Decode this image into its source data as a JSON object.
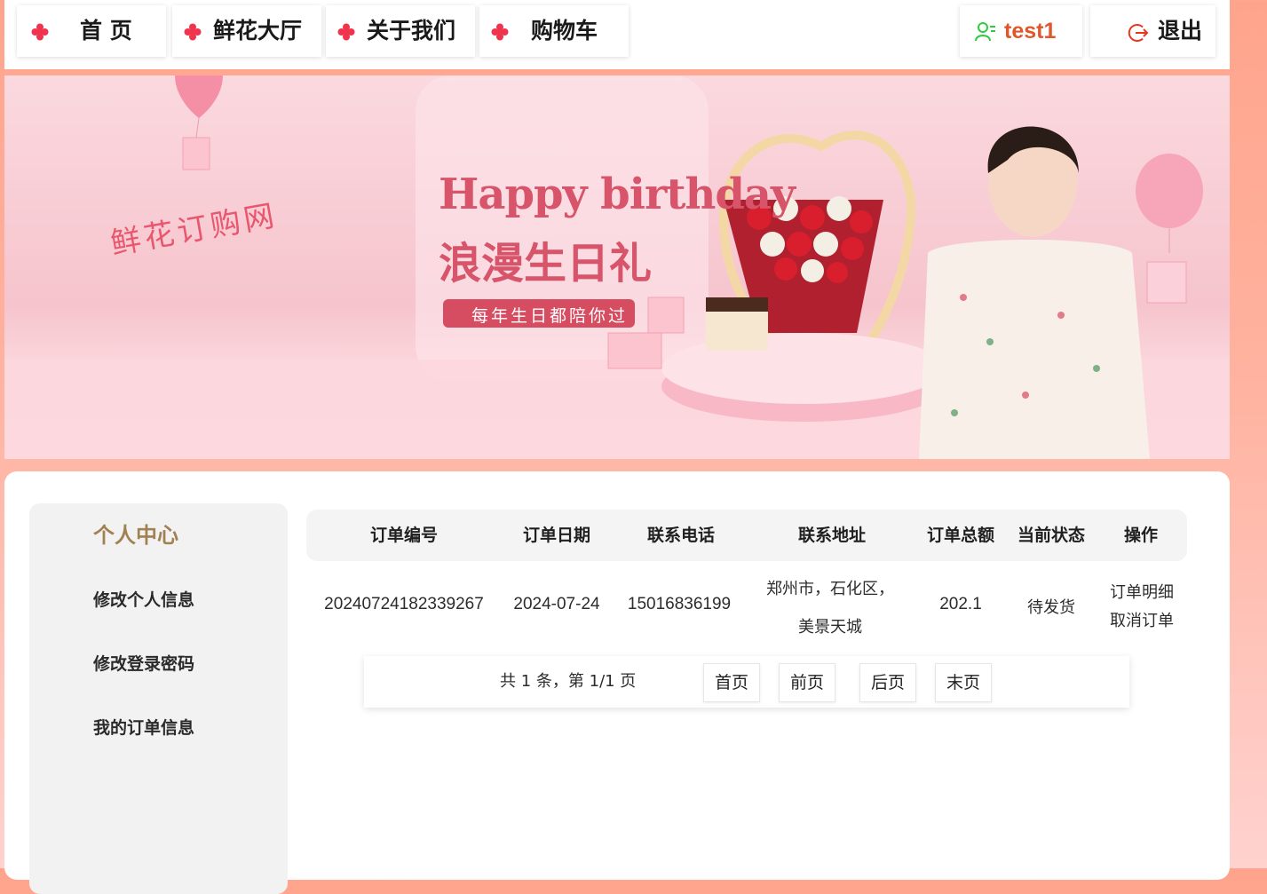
{
  "nav": {
    "items": [
      {
        "label": "首 页"
      },
      {
        "label": "鲜花大厅"
      },
      {
        "label": "关于我们"
      },
      {
        "label": "购物车"
      }
    ],
    "user": {
      "name": "test1"
    },
    "logout_label": "退出",
    "icon_color": "#f0344d",
    "user_icon_color": "#2ecc40",
    "logout_icon_color": "#e8361c"
  },
  "banner": {
    "logo_text": "鲜花订购网",
    "headline_en": "Happy birthday",
    "headline_cn": "浪漫生日礼",
    "tagline": "每年生日都陪你过"
  },
  "sidebar": {
    "title": "个人中心",
    "links": [
      {
        "label": "修改个人信息"
      },
      {
        "label": "修改登录密码"
      },
      {
        "label": "我的订单信息"
      }
    ]
  },
  "orders": {
    "columns": [
      "订单编号",
      "订单日期",
      "联系电话",
      "联系地址",
      "订单总额",
      "当前状态",
      "操作"
    ],
    "rows": [
      {
        "id": "20240724182339267",
        "date": "2024-07-24",
        "phone": "15016836199",
        "address_line1": "郑州市，石化区，",
        "address_line2": "美景天城",
        "total": "202.1",
        "status": "待发货",
        "action_detail": "订单明细",
        "action_cancel": "取消订单"
      }
    ]
  },
  "pager": {
    "info": "共 1 条，第 1/1 页",
    "first": "首页",
    "prev": "前页",
    "next": "后页",
    "last": "末页"
  }
}
